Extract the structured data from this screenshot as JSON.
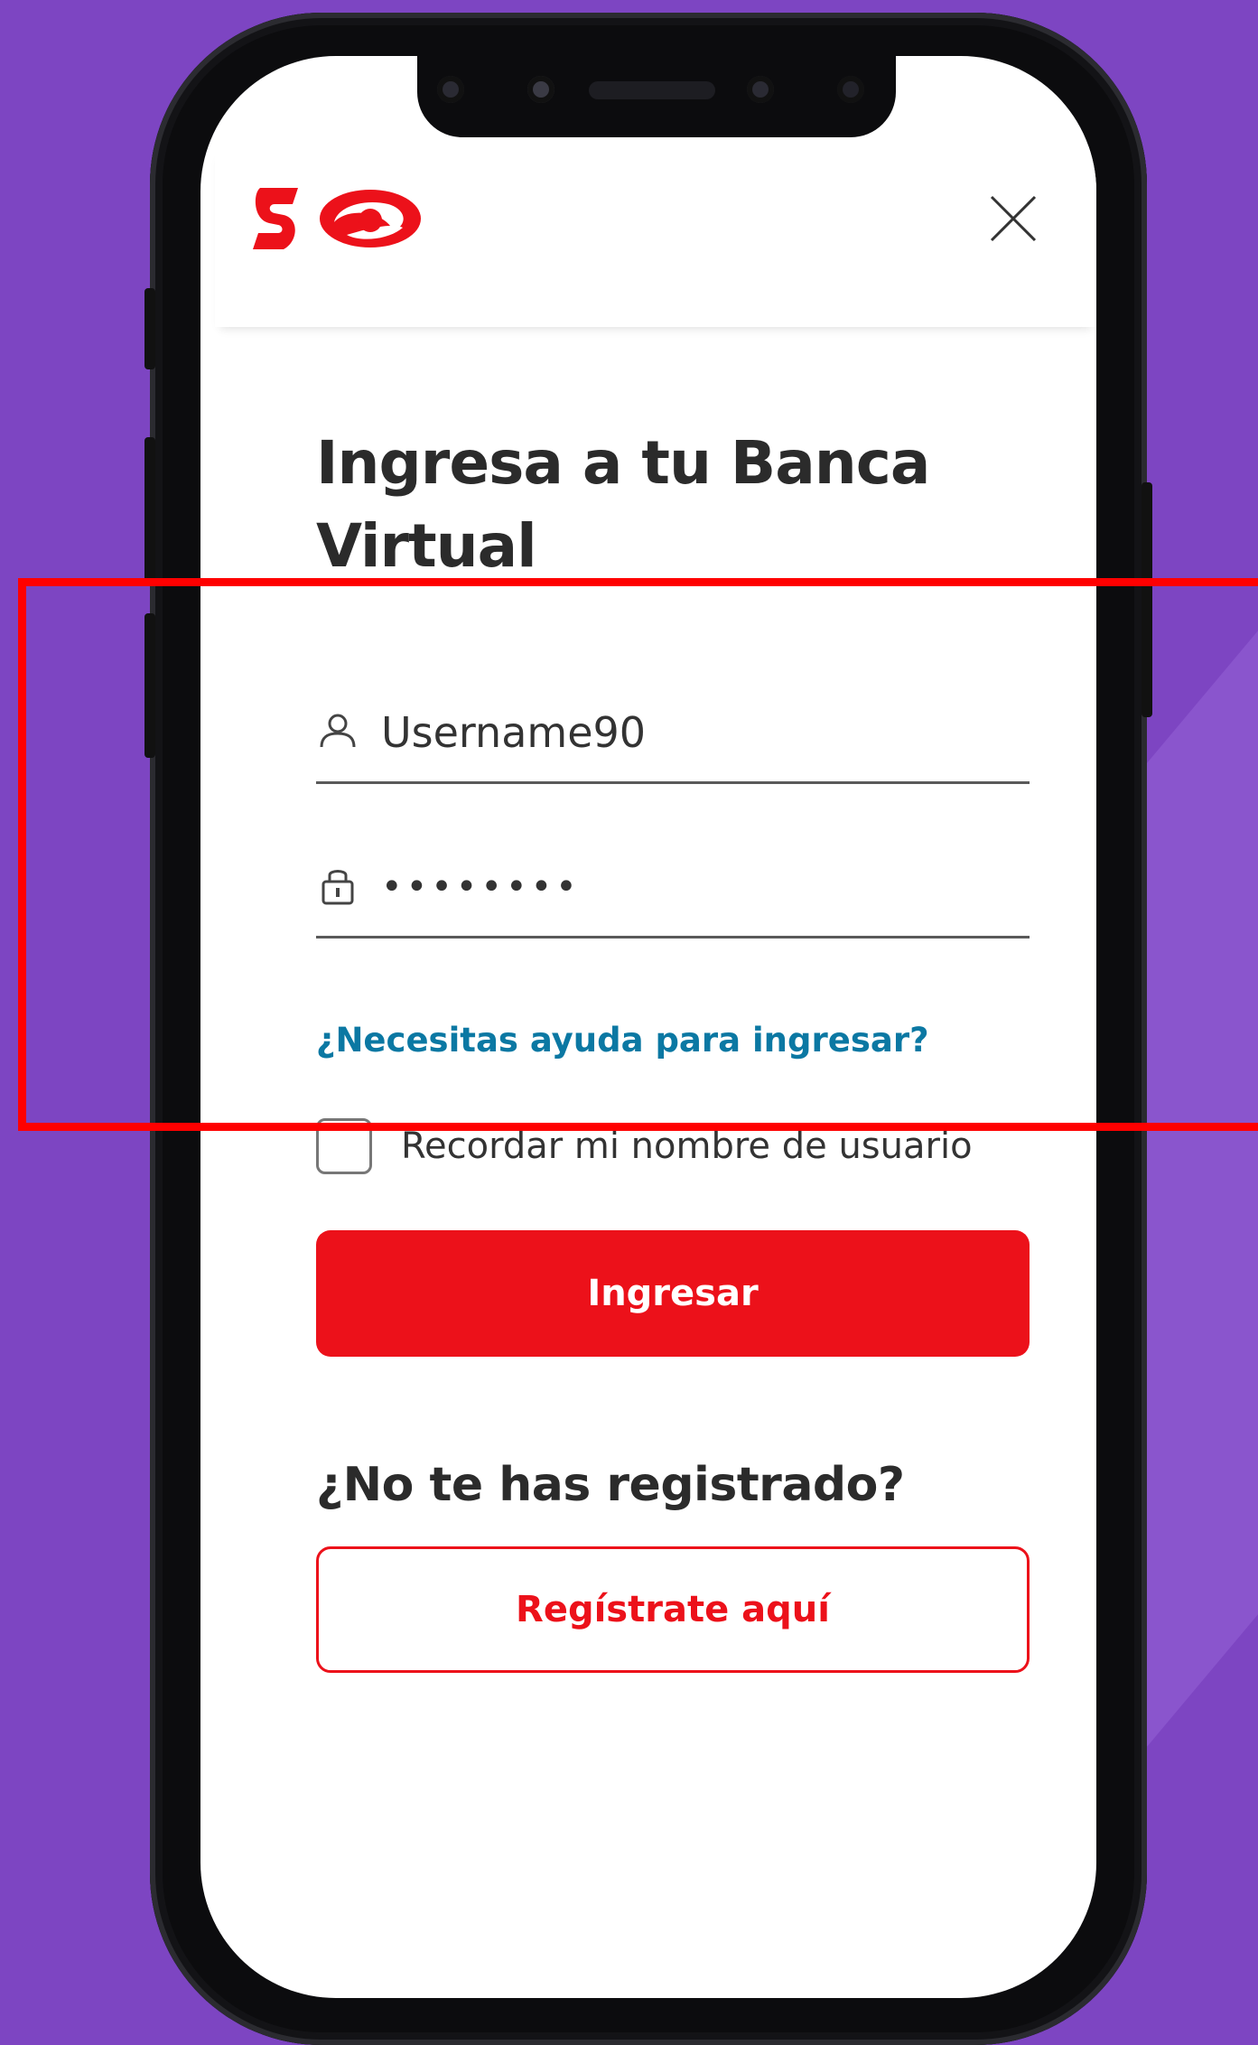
{
  "header": {
    "logo": "scotiabank-logo-icon",
    "close_icon": "close-icon"
  },
  "title": "Ingresa a tu Banca Virtual",
  "login_form": {
    "username": {
      "icon": "user-icon",
      "value": "Username90"
    },
    "password": {
      "icon": "lock-icon",
      "value": "••••••••"
    },
    "help_link": "¿Necesitas ayuda para ingresar?",
    "remember_label": "Recordar mi nombre de usuario",
    "remember_checked": false,
    "submit_label": "Ingresar"
  },
  "register": {
    "prompt": "¿No te has registrado?",
    "button_label": "Regístrate aquí"
  },
  "colors": {
    "background": "#7d45c2",
    "brand_red": "#ec111a",
    "link_blue": "#0b78a3",
    "highlight": "#ff0000"
  }
}
